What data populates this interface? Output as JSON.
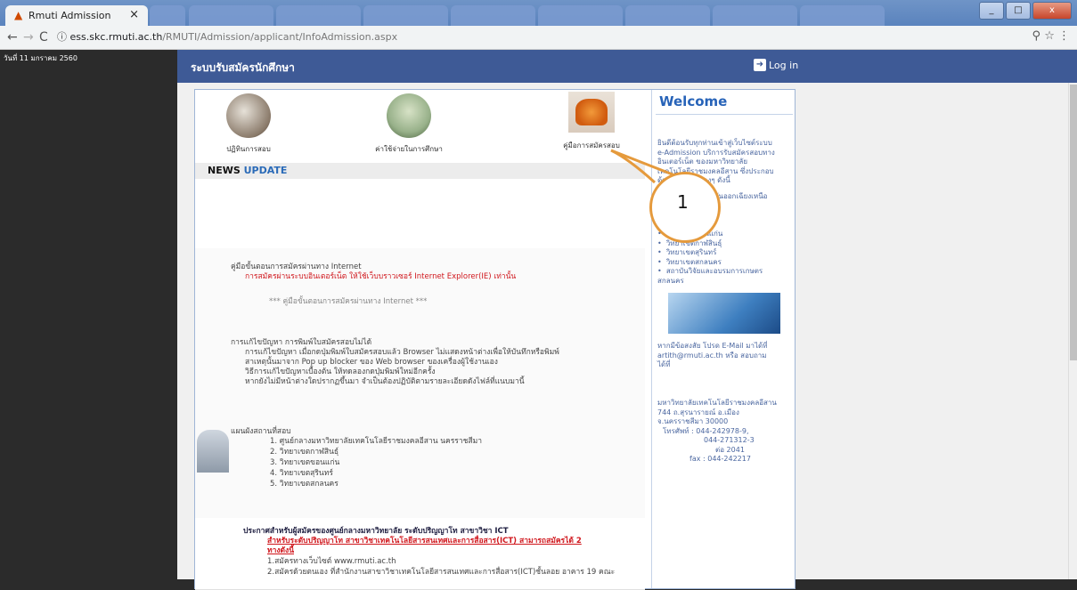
{
  "browser": {
    "active_tab_title": "Rmuti Admission",
    "tab_close": "×",
    "url_host": "ess.skc.rmuti.ac.th",
    "url_path": "/RMUTI/Admission/applicant/InfoAdmission.aspx",
    "win_min": "_",
    "win_max": "□",
    "win_close": "x"
  },
  "page": {
    "date": "วันที่ 11 มกราคม 2560",
    "site_title": "ระบบรับสมัครนักศึกษา",
    "login_label": "Log in"
  },
  "menu": {
    "item1": "ปฏิทินการสอบ",
    "item2": "ค่าใช้จ่ายในการศึกษา",
    "item3": "คู่มือการสมัครสอบ"
  },
  "news": {
    "word1": "NEWS",
    "word2": "UPDATE"
  },
  "section1": {
    "heading": "คู่มือขั้นตอนการสมัครผ่านทาง Internet",
    "warning": "การสมัครผ่านระบบอินเตอร์เน็ต ให้ใช้เว็บบราวเซอร์ Internet Explorer(IE) เท่านั้น",
    "link": "*** คู่มือขั้นตอนการสมัครผ่านทาง Internet ***"
  },
  "section2": {
    "heading": "การแก้ไขปัญหา การพิมพ์ใบสมัครสอบไม่ได้",
    "line1": "การแก้ไขปัญหา เมื่อกดปุ่มพิมพ์ใบสมัครสอบแล้ว Browser ไม่แสดงหน้าต่างเพื่อให้บันทึกหรือพิมพ์",
    "line2": "สาเหตุนั้นมาจาก Pop up blocker ของ Web browser ของเครื่องผู้ใช้งานเอง",
    "line3": "วิธีการแก้ไขปัญหาเบื้องต้น ให้ทดลองกดปุ่มพิมพ์ใหม่อีกครั้ง",
    "line4": "หากยังไม่มีหน้าต่างใดปรากฏขึ้นมา จำเป็นต้องปฏิบัติตามรายละเอียดดังไฟล์ที่แนบมานี้"
  },
  "section3": {
    "heading": "แผนผังสถานที่สอบ",
    "items": [
      "1. ศูนย์กลางมหาวิทยาลัยเทคโนโลยีราชมงคลอีสาน นครราชสีมา",
      "2. วิทยาเขตกาฬสินธุ์",
      "3. วิทยาเขตขอนแก่น",
      "4. วิทยาเขตสุรินทร์",
      "5. วิทยาเขตสกลนคร"
    ]
  },
  "section4": {
    "heading": "ประกาศสำหรับผู้สมัครของศูนย์กลางมหาวิทยาลัย ระดับปริญญาโท สาขาวิชา ICT",
    "red1": "สำหรับระดับปริญญาโท สาขาวิชาเทคโนโลยีสารสนเทศและการสื่อสาร(ICT) สามารถสมัครได้ 2",
    "red2": "ทางดังนี้",
    "line1": "1.สมัครทางเว็บไซต์ www.rmuti.ac.th",
    "line2": "2.สมัครด้วยตนเอง ที่สำนักงานสาขาวิชาเทคโนโลยีสารสนเทศและการสื่อสาร(ICT)ชั้นลอย อาคาร 19 คณะ"
  },
  "sidebar": {
    "welcome": "Welcome",
    "intro1": "ยินดีต้อนรับทุกท่านเข้าสู่เว็บไซต์ระบบ",
    "intro2": "e-Admission บริการรับสมัครสอบทาง",
    "intro3": "อินเตอร์เน็ต ของมหาวิทยาลัย",
    "intro4": "เทคโนโลยีราชมงคลอีสาน ซึ่งประกอบ",
    "intro5": "ด้วยวิทยาเขตต่างๆ ดังนี้",
    "intro6": "ศูนย์กลางภาคตะวันออกเฉียงเหนือ",
    "campuses": [
      "วิทยาเขตขอนแก่น",
      "วิทยาเขตกาฬสินธุ์",
      "วิทยาเขตสุรินทร์",
      "วิทยาเขตสกลนคร",
      "สถาบันวิจัยและอบรมการเกษตร"
    ],
    "campus_tail": "สกลนคร",
    "contact1": "หากมีข้อสงสัย โปรด E-Mail มาได้ที่",
    "contact2": "artith@rmuti.ac.th หรือ สอบถาม",
    "contact3": "ได้ที่",
    "addr1": "มหาวิทยาลัยเทคโนโลยีราชมงคลอีสาน",
    "addr2": "744 ถ.สุรนารายณ์ อ.เมือง",
    "addr3": "จ.นครราชสีมา 30000",
    "phone1": "โทรศัพท์ : 044-242978-9,",
    "phone2": "044-271312-3",
    "phone3": "ต่อ 2041",
    "fax": "fax : 044-242217"
  },
  "annotation": {
    "number": "1",
    "color": "#e59a3c"
  }
}
